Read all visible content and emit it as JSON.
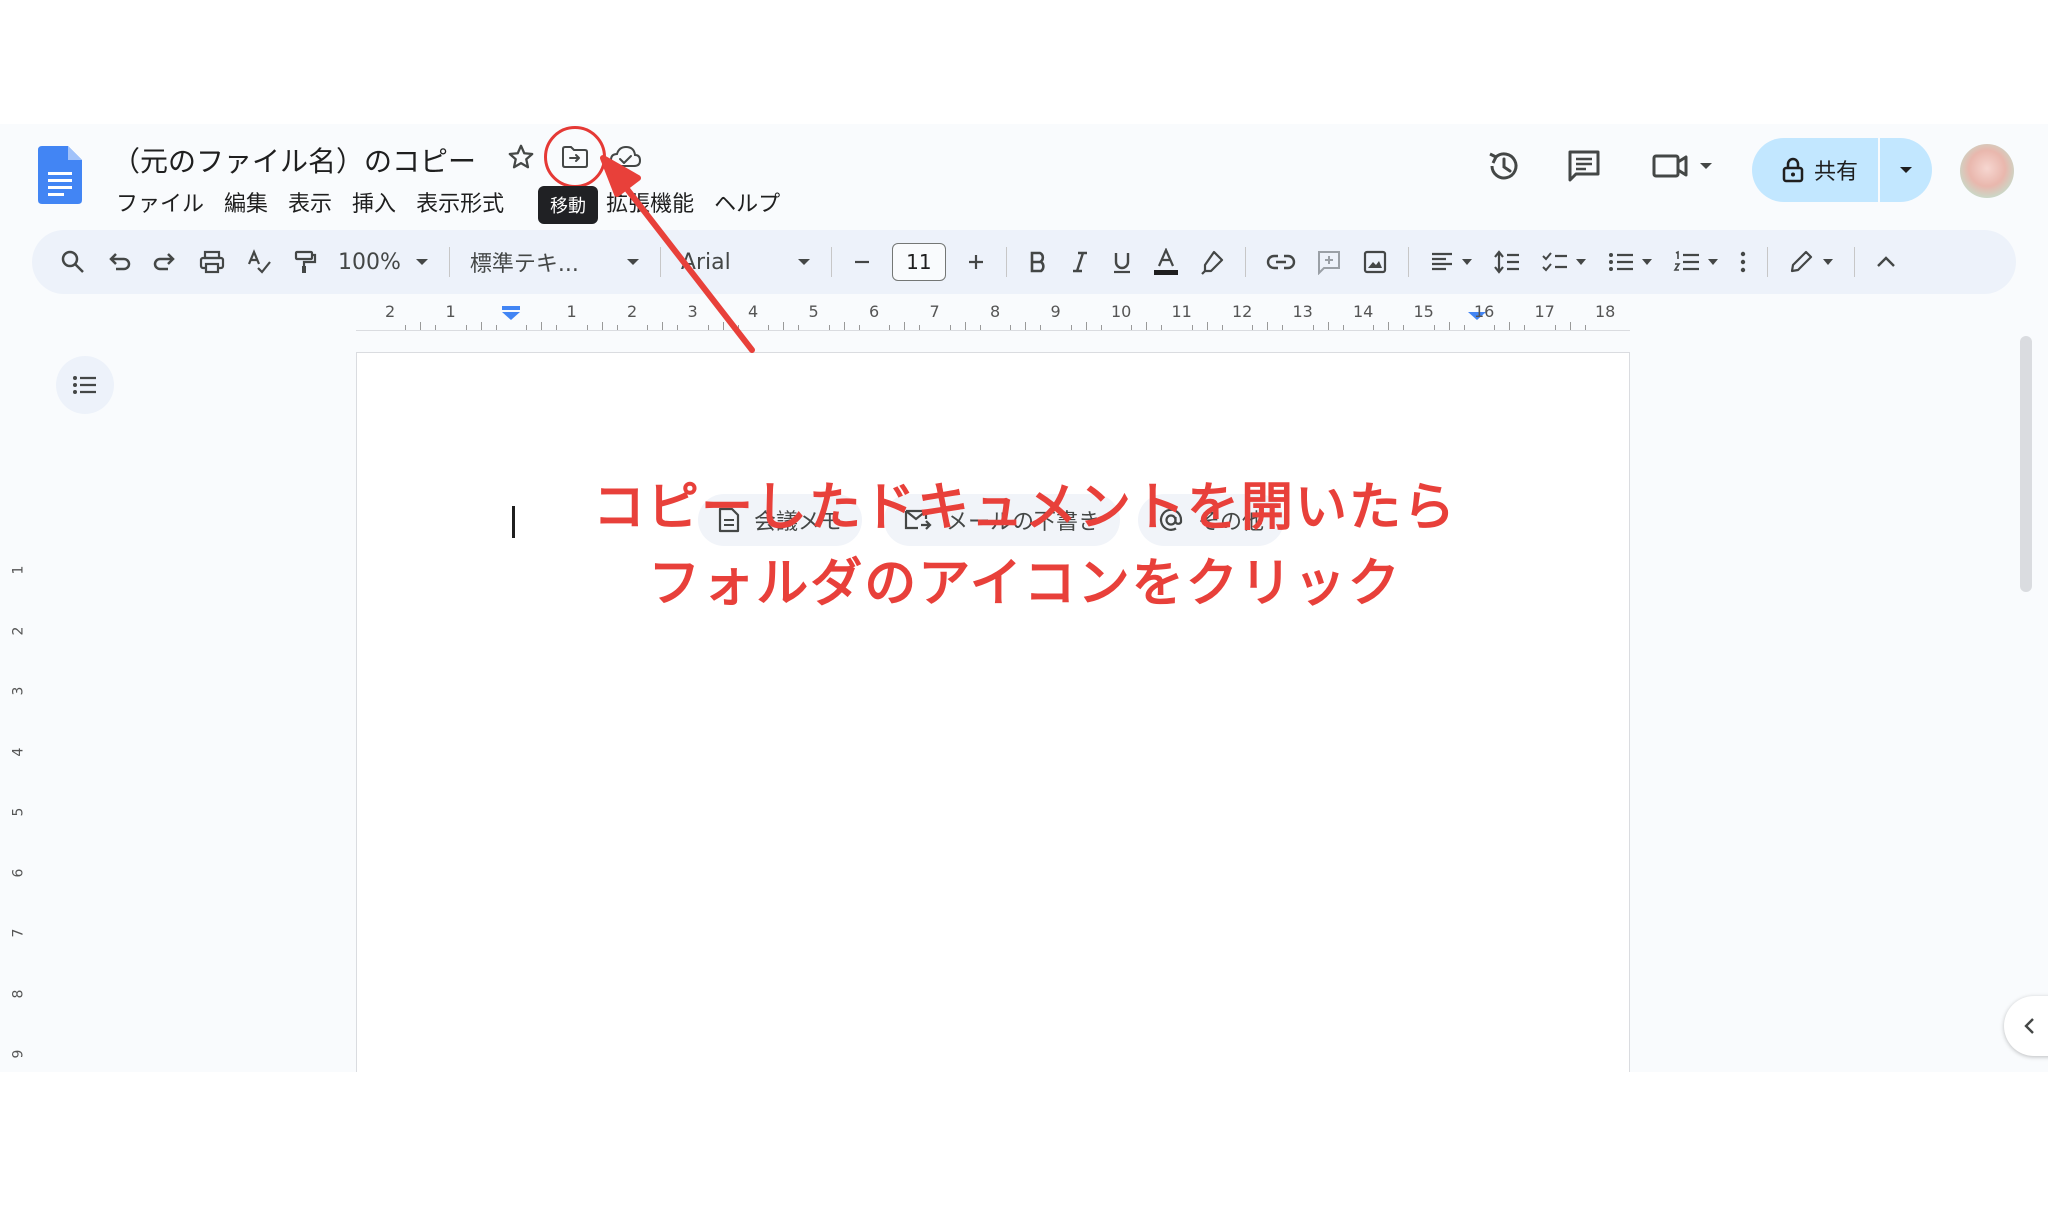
{
  "document": {
    "title": "（元のファイル名）のコピー",
    "move_tooltip": "移動"
  },
  "menubar": {
    "items": [
      "ファイル",
      "編集",
      "表示",
      "挿入",
      "表示形式",
      "拡張機能",
      "ヘルプ"
    ]
  },
  "header": {
    "share_label": "共有"
  },
  "toolbar": {
    "zoom": "100%",
    "paragraph_style": "標準テキ...",
    "font": "Arial",
    "font_size": "11"
  },
  "ruler": {
    "numbers": [
      "2",
      "1",
      "1",
      "2",
      "3",
      "4",
      "5",
      "6",
      "7",
      "8",
      "9",
      "10",
      "11",
      "12",
      "13",
      "14",
      "15",
      "16",
      "17",
      "18"
    ]
  },
  "vertical_ruler": {
    "numbers": [
      "1",
      "2",
      "3",
      "4",
      "5",
      "6",
      "7",
      "8",
      "9"
    ]
  },
  "chips": {
    "meeting_notes": "会議メモ",
    "email_draft": "メールの下書き",
    "more": "その他"
  },
  "annotation": {
    "line1": "コピーしたドキュメントを開いたら",
    "line2": "フォルダのアイコンをクリック",
    "color": "#e8403a"
  },
  "colors": {
    "share_button": "#c2e7ff",
    "toolbar_bg": "#edf2fa",
    "docs_blue": "#4285f4"
  }
}
